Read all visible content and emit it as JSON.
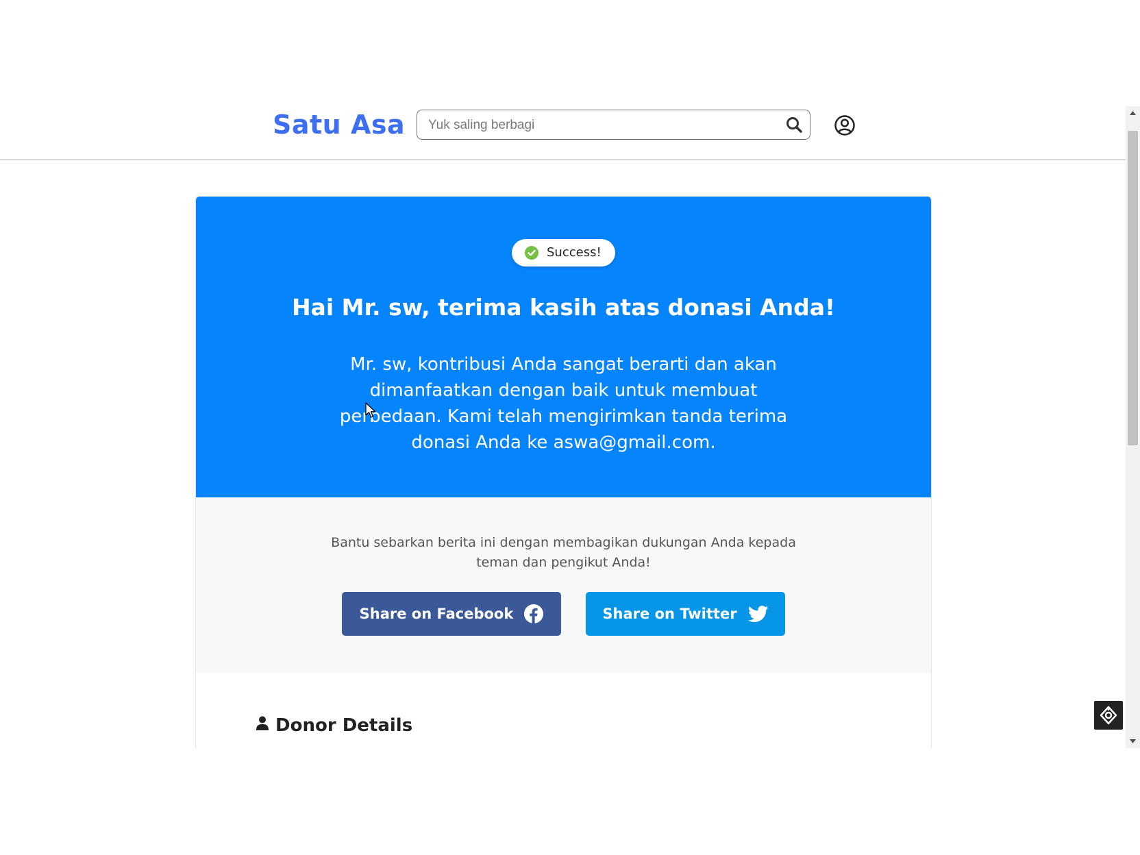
{
  "header": {
    "logo": "Satu Asa",
    "search_placeholder": "Yuk saling berbagi",
    "search_icon": "search-icon",
    "account_icon": "user-circle-icon"
  },
  "hero": {
    "badge_text": "Success!",
    "badge_icon": "check-circle-icon",
    "badge_color": "#76c043",
    "title": "Hai Mr. sw, terima kasih atas donasi Anda!",
    "message": "Mr. sw, kontribusi Anda sangat berarti dan akan dimanfaatkan dengan baik untuk membuat perbedaan. Kami telah mengirimkan tanda terima donasi Anda ke aswa@gmail.com.",
    "background_color": "#0684fc"
  },
  "share": {
    "text": "Bantu sebarkan berita ini dengan membagikan dukungan Anda kepada teman dan pengikut Anda!",
    "facebook_label": "Share on Facebook",
    "facebook_color": "#3b5998",
    "twitter_label": "Share on Twitter",
    "twitter_color": "#0795e8"
  },
  "donor": {
    "heading": "Donor Details",
    "icon": "user-icon"
  },
  "brand_color": "#3d6ff0"
}
